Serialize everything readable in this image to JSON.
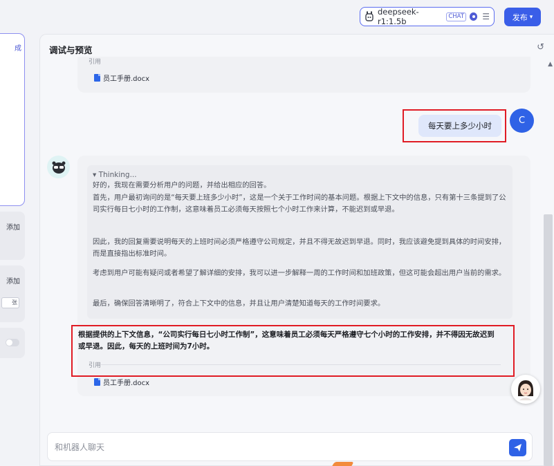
{
  "topbar": {
    "model_name": "deepseek-r1:1.5b",
    "model_tag": "CHAT",
    "publish_label": "发布"
  },
  "left": {
    "card1_label": "成",
    "card2_label": "添加",
    "card3_label": "添加",
    "card3_input_value": "张"
  },
  "panel": {
    "title": "调试与预览"
  },
  "previous": {
    "cite_label": "引用",
    "doc_name": "员工手册.docx"
  },
  "user_message": {
    "avatar_letter": "C",
    "text": "每天要上多少小时"
  },
  "answer": {
    "thinking_header": "▾ Thinking...",
    "thinking_paragraphs": [
      "好的，我现在需要分析用户的问题，并给出相应的回答。",
      "首先，用户最初询问的是“每天要上班多少小时”，这是一个关于工作时间的基本问题。根据上下文中的信息，只有第十三条提到了公司实行每日七小时的工作制，这意味着员工必须每天按照七个小时工作来计算，不能迟到或早退。",
      "因此，我的回复需要说明每天的上班时间必须严格遵守公司规定，并且不得无故迟到早退。同时，我应该避免提到具体的时间安排，而是直接指出标准时间。",
      "考虑到用户可能有疑问或者希望了解详细的安排，我可以进一步解释一周的工作时间和加班政策，但这可能会超出用户当前的需求。",
      "最后，确保回答清晰明了，符合上下文中的信息，并且让用户清楚知道每天的工作时间要求。"
    ],
    "final_text": "根据提供的上下文信息，“公司实行每日七小时工作制”，这意味着员工必须每天严格遵守七个小时的工作安排，并不得因无故迟到或早退。因此，每天的上班时间为7小时。",
    "cite_label": "引用",
    "doc_name": "员工手册.docx"
  },
  "composer": {
    "placeholder": "和机器人聊天"
  },
  "colors": {
    "accent": "#2f62e6",
    "highlight": "#e01b24"
  }
}
